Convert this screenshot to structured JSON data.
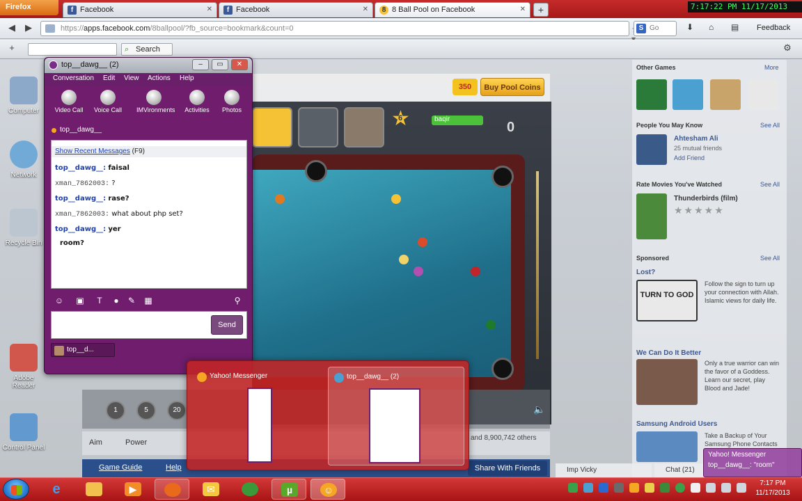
{
  "browser": {
    "app_button": "Firefox",
    "tabs": [
      {
        "label": "Facebook",
        "active": false
      },
      {
        "label": "Facebook",
        "active": false
      },
      {
        "label": "8 Ball Pool on Facebook",
        "active": true
      }
    ],
    "new_tab": "+",
    "clock": "7:17:22 PM 11/17/2013",
    "url_prefix": "https://",
    "url_host": "apps.facebook.com",
    "url_path": "/8ballpool/?fb_source=bookmark&count=0",
    "search_placeholder": "Go",
    "feedback": "Feedback",
    "toolbar_search": "Search"
  },
  "desktop_icons": [
    {
      "label": "Computer"
    },
    {
      "label": "Network"
    },
    {
      "label": "Recycle Bin"
    },
    {
      "label": "Adobe Reader"
    },
    {
      "label": "Control Panel"
    }
  ],
  "game": {
    "coins_badge": "350",
    "buy_coins": "Buy Pool Coins",
    "score": "0",
    "level": "6",
    "player_name": "baqir",
    "bets": [
      "1",
      "5",
      "20"
    ],
    "links": [
      "Aim",
      "Power"
    ],
    "online": "and 8,900,742 others",
    "footer": {
      "guide": "Game Guide",
      "help": "Help",
      "share": "Share With Friends"
    }
  },
  "sidebar": {
    "other_games": "Other Games",
    "more": "More",
    "people_header": "People You May Know",
    "see_all": "See All",
    "person_name": "Ahtesham Ali",
    "person_mutual": "25 mutual friends",
    "add_friend": "Add Friend",
    "rate_header": "Rate Movies You've Watched",
    "movie": "Thunderbirds (film)",
    "stars": "★★★★★",
    "sponsored": "Sponsored",
    "ad1_title": "Lost?",
    "ad1_text": "Follow the sign to turn up your connection with Allah. Islamic views for daily life.",
    "ad1_sign": "TURN TO GOD",
    "ad2_title": "We Can Do It Better",
    "ad2_text": "Only a true warrior can win the favor of a Goddess. Learn our secret, play Blood and Jade!",
    "ad3_title": "Samsung Android Users",
    "ad3_text": "Take a Backup of Your Samsung Phone Contacts",
    "chat_name": "Imp Vicky",
    "chat_label": "Chat (21)"
  },
  "messenger": {
    "title": "top__dawg__ (2)",
    "menu": [
      "Conversation",
      "Edit",
      "View",
      "Actions",
      "Help"
    ],
    "tools": [
      "Video Call",
      "Voice Call",
      "IMVironments",
      "Activities",
      "Photos"
    ],
    "contact": "top__dawg__",
    "recent_link": "Show Recent Messages",
    "recent_key": "(F9)",
    "messages": [
      {
        "who": "top__dawg__:",
        "text": "faisal",
        "me": true
      },
      {
        "who": "xman_7862003:",
        "text": "?",
        "me": false
      },
      {
        "who": "top__dawg__:",
        "text": "rase?",
        "me": true
      },
      {
        "who": "xman_7862003:",
        "text": "what about php set?",
        "me": false
      },
      {
        "who": "top__dawg__:",
        "text": "yer",
        "me": true
      },
      {
        "who": "",
        "text": "room?",
        "me": true
      }
    ],
    "send": "Send",
    "tab_label": "top__d..."
  },
  "preview": {
    "item1": "Yahoo! Messenger",
    "item2": "top__dawg__ (2)"
  },
  "toast": {
    "line1": "Yahoo! Messenger",
    "line2": "top__dawg__: \"room\""
  },
  "taskbar": {
    "time": "7:17 PM",
    "date": "11/17/2013"
  }
}
